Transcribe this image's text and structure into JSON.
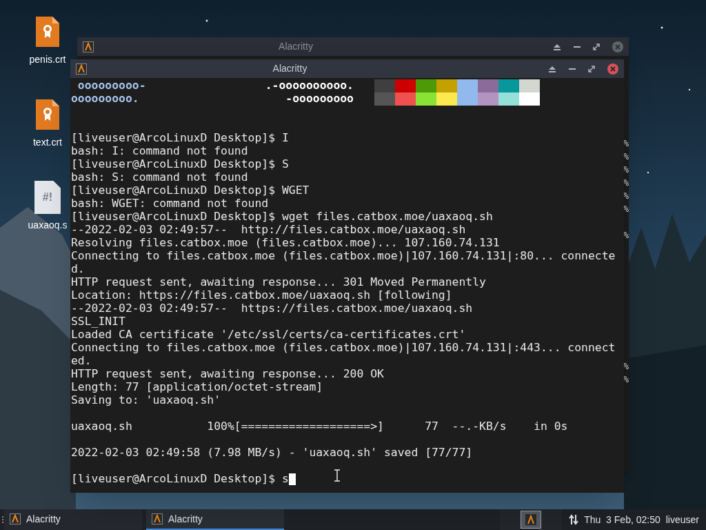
{
  "desktop_icons": [
    {
      "kind": "certificate",
      "label": "penis.crt"
    },
    {
      "kind": "certificate",
      "label": "text.crt"
    },
    {
      "kind": "script",
      "glyph": "#!",
      "label": "uaxaoq.s"
    }
  ],
  "back_window": {
    "title": "Alacritty",
    "lines": [
      {
        "kind": "blank"
      },
      {
        "kind": "blank"
      },
      {
        "kind": "blank"
      },
      {
        "kind": "blank"
      },
      {
        "kind": "text",
        "text": "%"
      },
      {
        "kind": "text",
        "text": "%"
      },
      {
        "kind": "text",
        "text": "%"
      },
      {
        "kind": "text",
        "text": "%"
      },
      {
        "kind": "text",
        "text": "%"
      },
      {
        "kind": "text",
        "text": "%"
      },
      {
        "kind": "blank"
      },
      {
        "kind": "text",
        "text": "%"
      },
      {
        "kind": "blank"
      },
      {
        "kind": "blank"
      },
      {
        "kind": "blank"
      },
      {
        "kind": "blank"
      },
      {
        "kind": "blank"
      },
      {
        "kind": "blank"
      },
      {
        "kind": "blank"
      },
      {
        "kind": "blank"
      },
      {
        "kind": "blank"
      },
      {
        "kind": "text",
        "text": "%"
      },
      {
        "kind": "text",
        "text": "%"
      }
    ]
  },
  "front_window": {
    "title": "Alacritty",
    "lines": [
      {
        "kind": "art",
        "left": " ooooooooo-",
        "right": ".-oooooooooo.",
        "swatches": [
          {
            "color": "#3f3f3f"
          },
          {
            "color": "#cc0000"
          },
          {
            "color": "#4e9a06"
          },
          {
            "color": "#c4a000"
          },
          {
            "color": "#91b9ee"
          },
          {
            "color": "#8c6a9c"
          },
          {
            "color": "#06989a"
          },
          {
            "color": "#d3d7cf"
          }
        ]
      },
      {
        "kind": "art",
        "left": "ooooooooo.",
        "right": "-ooooooooo",
        "swatches": [
          {
            "color": "#555555"
          },
          {
            "color": "#ef5050"
          },
          {
            "color": "#8ae234"
          },
          {
            "color": "#fce94f"
          },
          {
            "color": "#91b9ee"
          },
          {
            "color": "#b394c0"
          },
          {
            "color": "#95e0d8"
          },
          {
            "color": "#ffffff"
          }
        ]
      },
      {
        "kind": "blank"
      },
      {
        "kind": "blank"
      },
      {
        "kind": "text",
        "text": "[liveuser@ArcoLinuxD Desktop]$ I"
      },
      {
        "kind": "text",
        "text": "bash: I: command not found"
      },
      {
        "kind": "text",
        "text": "[liveuser@ArcoLinuxD Desktop]$ S"
      },
      {
        "kind": "text",
        "text": "bash: S: command not found"
      },
      {
        "kind": "text",
        "text": "[liveuser@ArcoLinuxD Desktop]$ WGET"
      },
      {
        "kind": "text",
        "text": "bash: WGET: command not found"
      },
      {
        "kind": "text",
        "text": "[liveuser@ArcoLinuxD Desktop]$ wget files.catbox.moe/uaxaoq.sh"
      },
      {
        "kind": "text",
        "text": "--2022-02-03 02:49:57--  http://files.catbox.moe/uaxaoq.sh"
      },
      {
        "kind": "text",
        "text": "Resolving files.catbox.moe (files.catbox.moe)... 107.160.74.131"
      },
      {
        "kind": "text",
        "text": "Connecting to files.catbox.moe (files.catbox.moe)|107.160.74.131|:80... connecte"
      },
      {
        "kind": "text",
        "text": "d."
      },
      {
        "kind": "text",
        "text": "HTTP request sent, awaiting response... 301 Moved Permanently"
      },
      {
        "kind": "text",
        "text": "Location: https://files.catbox.moe/uaxaoq.sh [following]"
      },
      {
        "kind": "text",
        "text": "--2022-02-03 02:49:57--  https://files.catbox.moe/uaxaoq.sh"
      },
      {
        "kind": "text",
        "text": "SSL_INIT"
      },
      {
        "kind": "text",
        "text": "Loaded CA certificate '/etc/ssl/certs/ca-certificates.crt'"
      },
      {
        "kind": "text",
        "text": "Connecting to files.catbox.moe (files.catbox.moe)|107.160.74.131|:443... connect"
      },
      {
        "kind": "text",
        "text": "ed."
      },
      {
        "kind": "text",
        "text": "HTTP request sent, awaiting response... 200 OK"
      },
      {
        "kind": "text",
        "text": "Length: 77 [application/octet-stream]"
      },
      {
        "kind": "text",
        "text": "Saving to: 'uaxaoq.sh'"
      },
      {
        "kind": "blank"
      },
      {
        "kind": "text",
        "text": "uaxaoq.sh           100%[===================>]      77  --.-KB/s    in 0s"
      },
      {
        "kind": "blank"
      },
      {
        "kind": "text",
        "text": "2022-02-03 02:49:58 (7.98 MB/s) - 'uaxaoq.sh' saved [77/77]"
      },
      {
        "kind": "blank"
      },
      {
        "kind": "input",
        "text": "[liveuser@ArcoLinuxD Desktop]$ s"
      }
    ]
  },
  "taskbar": {
    "tasks": [
      {
        "label": "Alacritty",
        "selected": false
      },
      {
        "label": "Alacritty",
        "selected": true
      }
    ],
    "clock": "Thu  3 Feb, 02:50",
    "user": "liveuser"
  }
}
